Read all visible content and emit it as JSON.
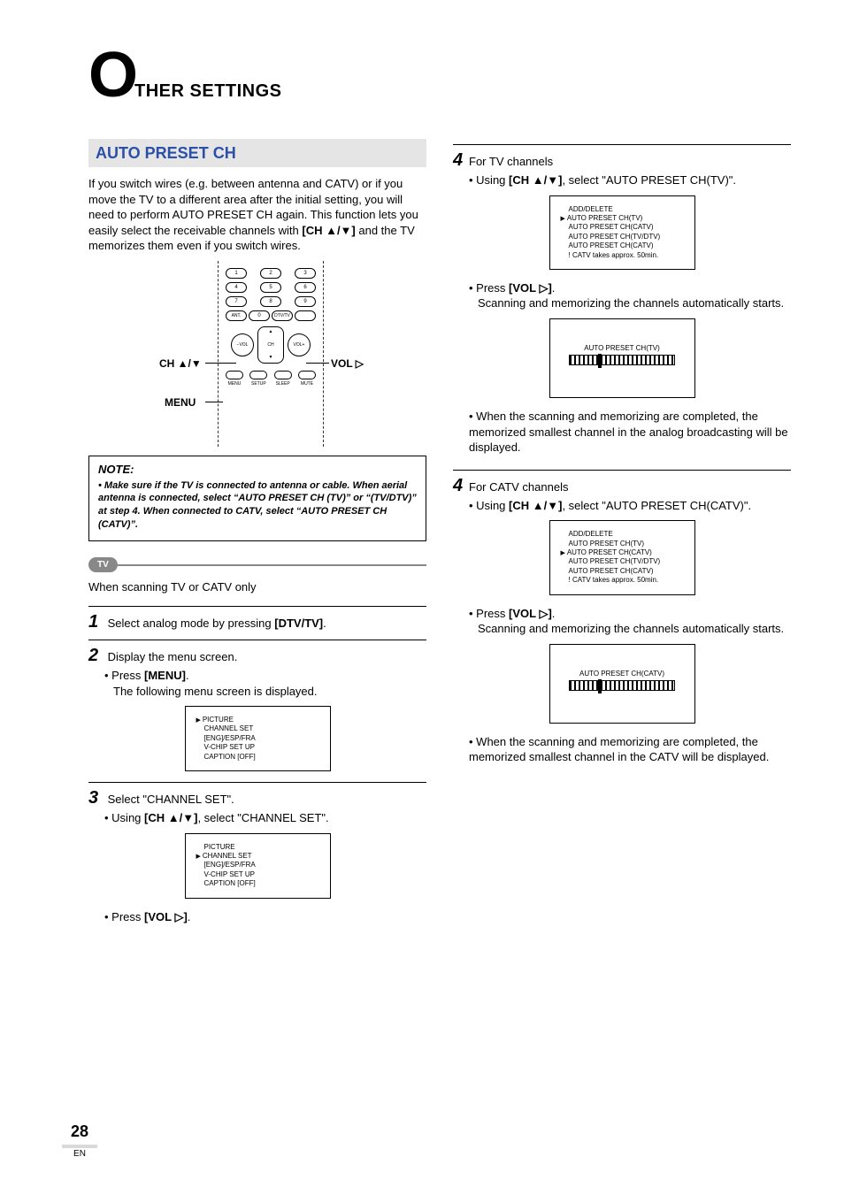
{
  "page": {
    "big_letter": "O",
    "title_rest": "THER SETTINGS",
    "number": "28",
    "en": "EN"
  },
  "section": {
    "header": "AUTO PRESET CH",
    "intro_pre": "If you switch wires (e.g. between antenna and CATV) or if you move the TV to a different area after the initial setting, you will need to perform AUTO PRESET CH again. This function lets you easily select the receivable channels with ",
    "intro_bold": "[CH ▲/▼]",
    "intro_post": " and the TV memorizes them even if you switch wires."
  },
  "remote": {
    "numbers": [
      "1",
      "2",
      "3",
      "4",
      "5",
      "6",
      "7",
      "8",
      "9",
      "0"
    ],
    "ant": "ANT.",
    "dtv": "DTV/TV",
    "vol_minus": "−VOL",
    "vol_plus": "VOL+",
    "ch": "CH",
    "menu_items": [
      "MENU",
      "SETUP",
      "SLEEP",
      "MUTE"
    ],
    "callout_ch": "CH ▲/▼",
    "callout_menu": "MENU",
    "callout_vol": "VOL ▷"
  },
  "note": {
    "title": "NOTE:",
    "body": "• Make sure if the TV is connected to antenna or cable. When aerial antenna is connected, select “AUTO PRESET CH (TV)” or “(TV/DTV)” at step 4.  When connected to CATV, select “AUTO PRESET CH (CATV)”."
  },
  "tv_tag": "TV",
  "subhead": "When scanning TV or CATV only",
  "step1": {
    "num": "1",
    "text_pre": "Select analog mode by pressing ",
    "bold": "[DTV/TV]",
    "text_post": "."
  },
  "step2": {
    "num": "2",
    "text": "Display the menu screen.",
    "sub_pre": "Press ",
    "sub_bold": "[MENU]",
    "sub_post": ".",
    "sub_line2": "The following menu screen is displayed."
  },
  "menu_screen": {
    "items": [
      "PICTURE",
      "CHANNEL SET",
      "[ENG]/ESP/FRA",
      "V-CHIP SET UP",
      "CAPTION [OFF]"
    ],
    "selected": 0
  },
  "step3": {
    "num": "3",
    "text": "Select \"CHANNEL SET\".",
    "sub_pre": "Using ",
    "sub_bold": "[CH ▲/▼]",
    "sub_post": ", select \"CHANNEL SET\"."
  },
  "menu_screen2_selected": 1,
  "step3_press_pre": "Press ",
  "step3_press_bold": "[VOL ▷]",
  "step3_press_post": ".",
  "right": {
    "step4a": {
      "num": "4",
      "text": "For TV channels",
      "sub_pre": "Using ",
      "sub_bold": "[CH ▲/▼]",
      "sub_post": ", select \"AUTO PRESET CH(TV)\"."
    },
    "preset_screen": {
      "items": [
        "ADD/DELETE",
        "AUTO PRESET CH(TV)",
        "AUTO PRESET CH(CATV)",
        "AUTO PRESET CH(TV/DTV)",
        "AUTO PRESET CH(CATV)",
        "! CATV takes approx. 50min."
      ],
      "selected": 1
    },
    "press_pre": "Press ",
    "press_bold": "[VOL ▷]",
    "press_post": ".",
    "scan_line": "Scanning and memorizing the channels automatically starts.",
    "prog_label_tv": "AUTO PRESET CH(TV)",
    "result_tv": "When the scanning and memorizing are completed, the memorized smallest channel in the analog broadcasting will be displayed.",
    "step4b": {
      "num": "4",
      "text": "For CATV channels",
      "sub_pre": "Using ",
      "sub_bold": "[CH ▲/▼]",
      "sub_post": ", select \"AUTO PRESET CH(CATV)\"."
    },
    "preset_screen2_selected": 2,
    "prog_label_catv": "AUTO PRESET CH(CATV)",
    "result_catv": "When the scanning and memorizing are completed, the memorized smallest channel in the CATV will be displayed."
  }
}
